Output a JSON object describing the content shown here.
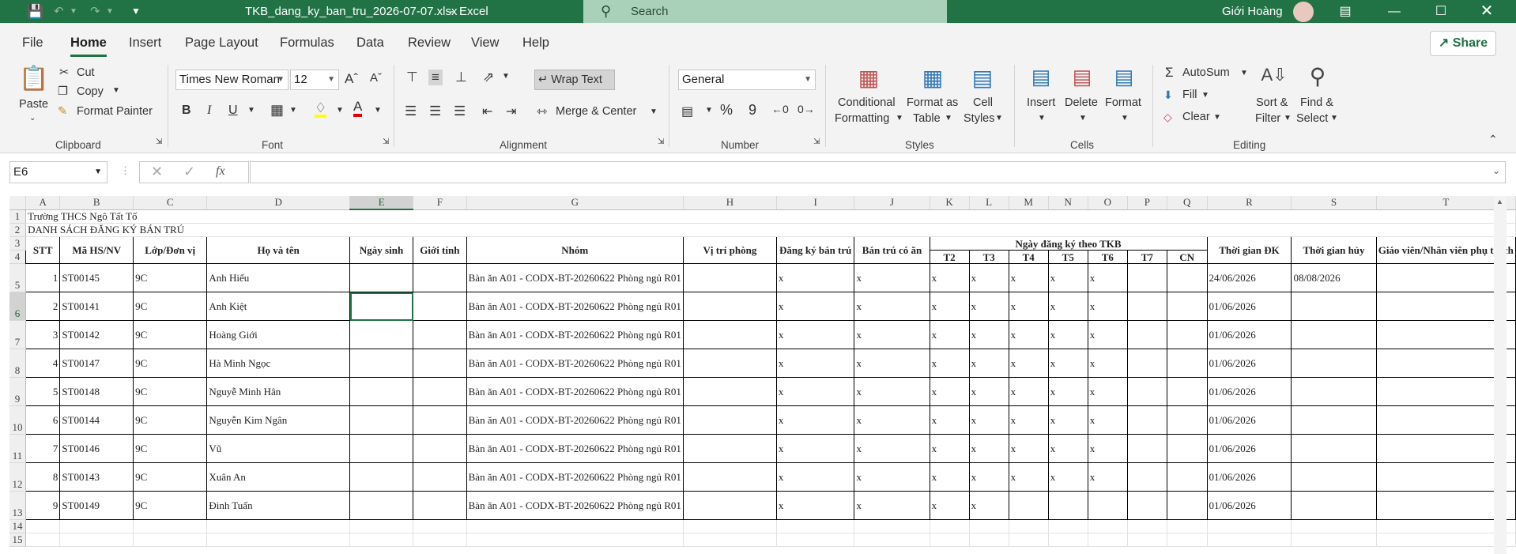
{
  "title_bar": {
    "filename": "TKB_dang_ky_ban_tru_2026-07-07.xlsx",
    "app": "Excel",
    "separator": "-",
    "search_placeholder": "Search",
    "user_name": "Giới Hoàng"
  },
  "menu": {
    "tabs": [
      "File",
      "Home",
      "Insert",
      "Page Layout",
      "Formulas",
      "Data",
      "Review",
      "View",
      "Help"
    ],
    "share_label": "Share"
  },
  "ribbon": {
    "clipboard": {
      "paste": "Paste",
      "cut": "Cut",
      "copy": "Copy",
      "format_painter": "Format Painter",
      "group": "Clipboard"
    },
    "font": {
      "name": "Times New Roman",
      "size": "12",
      "bold": "B",
      "italic": "I",
      "underline": "U",
      "group": "Font"
    },
    "alignment": {
      "wrap_text": "Wrap Text",
      "merge_center": "Merge & Center",
      "group": "Alignment"
    },
    "number": {
      "format": "General",
      "percent": "%",
      "comma": "9",
      "group": "Number"
    },
    "styles": {
      "conditional_1": "Conditional",
      "conditional_2": "Formatting",
      "format_table_1": "Format as",
      "format_table_2": "Table",
      "cell_styles_1": "Cell",
      "cell_styles_2": "Styles",
      "group": "Styles"
    },
    "cells": {
      "insert": "Insert",
      "delete": "Delete",
      "format": "Format",
      "group": "Cells"
    },
    "editing": {
      "autosum": "AutoSum",
      "fill": "Fill",
      "clear": "Clear",
      "sort_1": "Sort &",
      "sort_2": "Filter",
      "find_1": "Find &",
      "find_2": "Select",
      "group": "Editing"
    }
  },
  "formula_bar": {
    "name_box": "E6",
    "fx": "fx",
    "value": ""
  },
  "sheet": {
    "columns": [
      "A",
      "B",
      "C",
      "D",
      "E",
      "F",
      "G",
      "H",
      "I",
      "J",
      "K",
      "L",
      "M",
      "N",
      "O",
      "P",
      "Q",
      "R",
      "S",
      "T"
    ],
    "selected_column": "E",
    "selected_row": "6",
    "row1": "Trường THCS Ngô Tất Tố",
    "row2": "DANH SÁCH ĐĂNG KÝ BÁN TRÚ",
    "headers": {
      "stt": "STT",
      "ma": "Mã HS/NV",
      "lop": "Lớp/Đơn vị",
      "hoten": "Họ và tên",
      "ngaysinh": "Ngày sinh",
      "gioitinh": "Giới tính",
      "nhom": "Nhóm",
      "vitri": "Vị trí phòng",
      "dangky": "Đăng ký bán trú",
      "bantru": "Bán trú có ăn",
      "ngaydk": "Ngày đăng ký theo TKB",
      "days": [
        "T2",
        "T3",
        "T4",
        "T5",
        "T6",
        "T7",
        "CN"
      ],
      "tgdk": "Thời gian ĐK",
      "tghuy": "Thời gian hủy",
      "gv": "Giáo viên/Nhân viên phụ trách"
    },
    "rows": [
      {
        "row": "5",
        "stt": "1",
        "ma": "ST00145",
        "lop": "9C",
        "ten": "Anh Hiếu",
        "nhom": "Bàn ăn A01 - CODX-BT-20260622 Phòng ngủ R01",
        "dk": "x",
        "bt": "x",
        "days": [
          "x",
          "x",
          "x",
          "x",
          "x",
          "",
          ""
        ],
        "tgdk": "24/06/2026",
        "tghuy": "08/08/2026"
      },
      {
        "row": "6",
        "stt": "2",
        "ma": "ST00141",
        "lop": "9C",
        "ten": "Anh Kiệt",
        "nhom": "Bàn ăn A01 - CODX-BT-20260622 Phòng ngủ R01",
        "dk": "x",
        "bt": "x",
        "days": [
          "x",
          "x",
          "x",
          "x",
          "x",
          "",
          ""
        ],
        "tgdk": "01/06/2026",
        "tghuy": ""
      },
      {
        "row": "7",
        "stt": "3",
        "ma": "ST00142",
        "lop": "9C",
        "ten": "Hoàng Giới",
        "nhom": "Bàn ăn A01 - CODX-BT-20260622 Phòng ngủ R01",
        "dk": "x",
        "bt": "x",
        "days": [
          "x",
          "x",
          "x",
          "x",
          "x",
          "",
          ""
        ],
        "tgdk": "01/06/2026",
        "tghuy": ""
      },
      {
        "row": "8",
        "stt": "4",
        "ma": "ST00147",
        "lop": "9C",
        "ten": "Hà Minh Ngọc",
        "nhom": "Bàn ăn A01 - CODX-BT-20260622 Phòng ngủ R01",
        "dk": "x",
        "bt": "x",
        "days": [
          "x",
          "x",
          "x",
          "x",
          "x",
          "",
          ""
        ],
        "tgdk": "01/06/2026",
        "tghuy": ""
      },
      {
        "row": "9",
        "stt": "5",
        "ma": "ST00148",
        "lop": "9C",
        "ten": "Nguyễ Minh Hân",
        "nhom": "Bàn ăn A01 - CODX-BT-20260622 Phòng ngủ R01",
        "dk": "x",
        "bt": "x",
        "days": [
          "x",
          "x",
          "x",
          "x",
          "x",
          "",
          ""
        ],
        "tgdk": "01/06/2026",
        "tghuy": ""
      },
      {
        "row": "10",
        "stt": "6",
        "ma": "ST00144",
        "lop": "9C",
        "ten": "Nguyễn Kim Ngân",
        "nhom": "Bàn ăn A01 - CODX-BT-20260622 Phòng ngủ R01",
        "dk": "x",
        "bt": "x",
        "days": [
          "x",
          "x",
          "x",
          "x",
          "x",
          "",
          ""
        ],
        "tgdk": "01/06/2026",
        "tghuy": ""
      },
      {
        "row": "11",
        "stt": "7",
        "ma": "ST00146",
        "lop": "9C",
        "ten": "Vũ",
        "nhom": "Bàn ăn A01 - CODX-BT-20260622 Phòng ngủ R01",
        "dk": "x",
        "bt": "x",
        "days": [
          "x",
          "x",
          "x",
          "x",
          "x",
          "",
          ""
        ],
        "tgdk": "01/06/2026",
        "tghuy": ""
      },
      {
        "row": "12",
        "stt": "8",
        "ma": "ST00143",
        "lop": "9C",
        "ten": "Xuân An",
        "nhom": "Bàn ăn A01 - CODX-BT-20260622 Phòng ngủ R01",
        "dk": "x",
        "bt": "x",
        "days": [
          "x",
          "x",
          "x",
          "x",
          "x",
          "",
          ""
        ],
        "tgdk": "01/06/2026",
        "tghuy": ""
      },
      {
        "row": "13",
        "stt": "9",
        "ma": "ST00149",
        "lop": "9C",
        "ten": "Đinh Tuấn",
        "nhom": "Bàn ăn A01 - CODX-BT-20260622 Phòng ngủ R01",
        "dk": "x",
        "bt": "x",
        "days": [
          "x",
          "x",
          "",
          "",
          "",
          "",
          ""
        ],
        "tgdk": "01/06/2026",
        "tghuy": ""
      }
    ],
    "extra_rows": [
      "14",
      "15"
    ]
  },
  "colors": {
    "accent": "#217346",
    "search_bg": "#a9d1b9"
  }
}
